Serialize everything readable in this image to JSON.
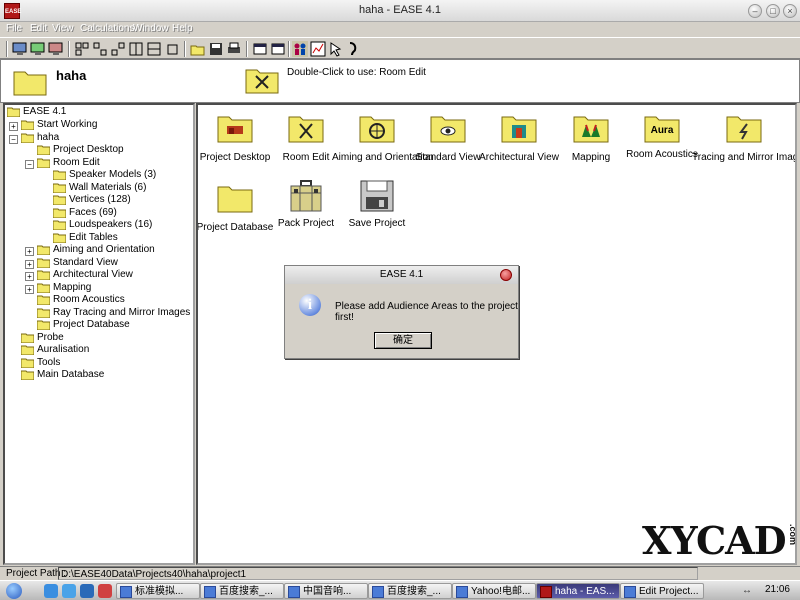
{
  "window": {
    "title": "haha - EASE 4.1",
    "app_icon": "EASE"
  },
  "menu": [
    "File",
    "Edit",
    "View",
    "Calculations",
    "Window",
    "Help"
  ],
  "header": {
    "title": "haha",
    "hint": "Double-Click to use: Room Edit"
  },
  "tree": {
    "items": [
      {
        "label": "EASE 4.1"
      },
      {
        "label": "Start Working"
      },
      {
        "label": "haha"
      },
      {
        "label": "Project Desktop"
      },
      {
        "label": "Room Edit"
      },
      {
        "label": "Speaker Models (3)"
      },
      {
        "label": "Wall Materials (6)"
      },
      {
        "label": "Vertices (128)"
      },
      {
        "label": "Faces (69)"
      },
      {
        "label": "Loudspeakers (16)"
      },
      {
        "label": "Edit Tables"
      },
      {
        "label": "Aiming and Orientation"
      },
      {
        "label": "Standard View"
      },
      {
        "label": "Architectural View"
      },
      {
        "label": "Mapping"
      },
      {
        "label": "Room Acoustics"
      },
      {
        "label": "Ray Tracing and Mirror Images"
      },
      {
        "label": "Project Database"
      },
      {
        "label": "Probe"
      },
      {
        "label": "Auralisation"
      },
      {
        "label": "Tools"
      },
      {
        "label": "Main Database"
      }
    ]
  },
  "icons": [
    {
      "label": "Project Desktop",
      "glyph": "desktop-icon"
    },
    {
      "label": "Room Edit",
      "glyph": "compass-icon"
    },
    {
      "label": "Aiming and Orientation",
      "glyph": "crosshair-icon"
    },
    {
      "label": "Standard View",
      "glyph": "eye-icon"
    },
    {
      "label": "Architectural View",
      "glyph": "arch-icon"
    },
    {
      "label": "Mapping",
      "glyph": "map-icon"
    },
    {
      "label": "Room Acoustics",
      "glyph": "Aura"
    },
    {
      "label": "Tracing and Mirror Images",
      "glyph": "ray-icon"
    },
    {
      "label": "Project Database",
      "glyph": "folder-icon"
    },
    {
      "label": "Pack Project",
      "glyph": "suitcase-icon"
    },
    {
      "label": "Save Project",
      "glyph": "floppy-icon"
    }
  ],
  "dialog": {
    "title": "EASE 4.1",
    "message": "Please add Audience Areas to the project first!",
    "ok_label": "确定"
  },
  "status": {
    "label": "Project Path :",
    "path": "D:\\EASE40Data\\Projects40\\haha\\project1"
  },
  "taskbar": {
    "tasks": [
      {
        "label": "标准模拟..."
      },
      {
        "label": "百度搜索_..."
      },
      {
        "label": "中国音响..."
      },
      {
        "label": "百度搜索_..."
      },
      {
        "label": "Yahoo!电邮..."
      },
      {
        "label": "haha - EAS..."
      },
      {
        "label": "Edit Project..."
      }
    ],
    "clock": "21:06"
  },
  "watermark": {
    "text": "XYCAD",
    "suffix": ".com"
  },
  "colors": {
    "folder": "#f2e86a",
    "folder_edge": "#7a6a10",
    "active_task": "#3a3a7a"
  }
}
